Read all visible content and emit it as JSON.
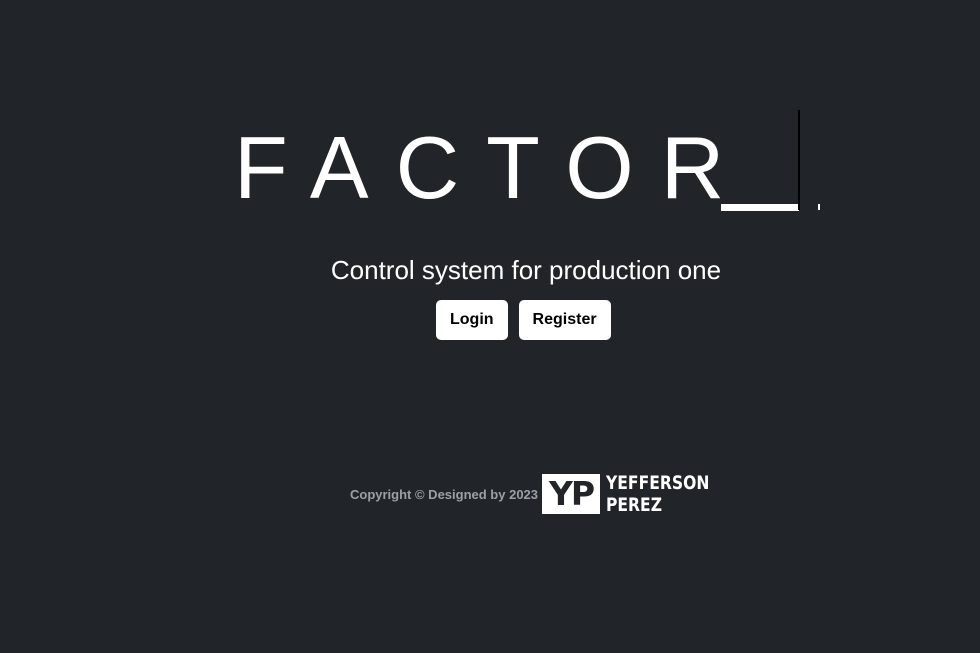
{
  "brand": {
    "title": "FACTOR"
  },
  "tagline": "Control system for production one",
  "actions": {
    "login_label": "Login",
    "register_label": "Register"
  },
  "footer": {
    "copyright": "Copyright © Designed by 2023",
    "logo_mark": "YP",
    "logo_line1": "YEFFERSON",
    "logo_line2": "PEREZ"
  },
  "colors": {
    "background": "#212529",
    "text": "#ffffff",
    "button_bg": "#ffffff",
    "footer_text": "#9aa0a6"
  }
}
